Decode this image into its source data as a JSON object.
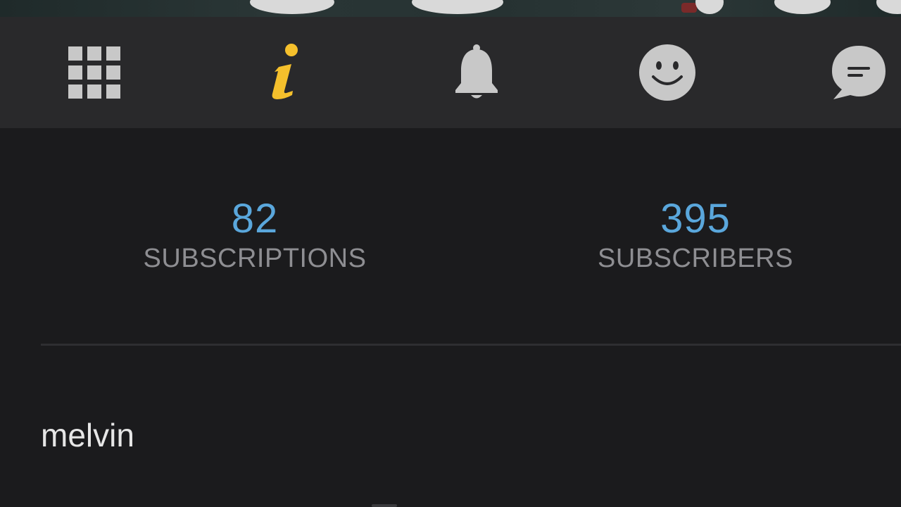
{
  "tabs": [
    {
      "icon": "grid-icon",
      "active": false
    },
    {
      "icon": "info-icon",
      "active": true
    },
    {
      "icon": "bell-icon",
      "active": false
    },
    {
      "icon": "smiley-icon",
      "active": false
    },
    {
      "icon": "chat-bubble-icon",
      "active": false
    }
  ],
  "colors": {
    "background": "#1b1b1d",
    "tabbar": "#29292b",
    "icon": "#c8c8c8",
    "active_icon": "#f5c02c",
    "stat_number": "#5aa7dc",
    "stat_label": "#8e8e92",
    "username": "#e6e6e6"
  },
  "stats": {
    "subscriptions": {
      "value": "82",
      "label": "SUBSCRIPTIONS"
    },
    "subscribers": {
      "value": "395",
      "label": "SUBSCRIBERS"
    }
  },
  "profile": {
    "username": "melvin"
  }
}
